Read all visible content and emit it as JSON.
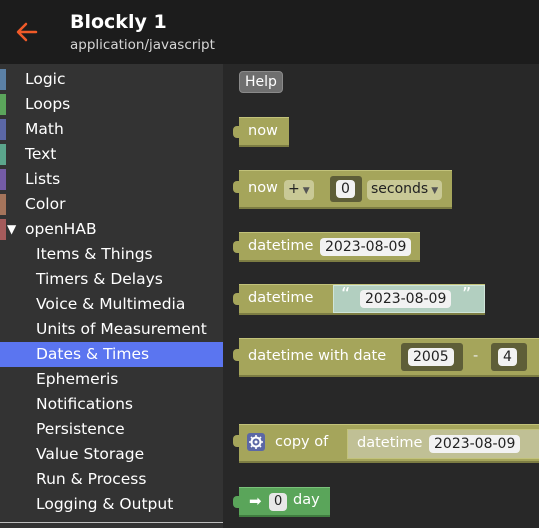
{
  "header": {
    "title": "Blockly 1",
    "subtitle": "application/javascript"
  },
  "toolbox": {
    "categories": [
      {
        "label": "Logic",
        "color": "#5b80a5"
      },
      {
        "label": "Loops",
        "color": "#5ba55b"
      },
      {
        "label": "Math",
        "color": "#5b67a5"
      },
      {
        "label": "Text",
        "color": "#5ba58c"
      },
      {
        "label": "Lists",
        "color": "#745ba5"
      },
      {
        "label": "Color",
        "color": "#a5745b"
      },
      {
        "label": "openHAB",
        "color": "#a55b5b"
      }
    ],
    "subcategories": [
      {
        "label": "Items & Things"
      },
      {
        "label": "Timers & Delays"
      },
      {
        "label": "Voice & Multimedia"
      },
      {
        "label": "Units of Measurement"
      },
      {
        "label": "Dates & Times",
        "selected": true
      },
      {
        "label": "Ephemeris"
      },
      {
        "label": "Notifications"
      },
      {
        "label": "Persistence"
      },
      {
        "label": "Value Storage"
      },
      {
        "label": "Run & Process"
      },
      {
        "label": "Logging & Output"
      }
    ],
    "expand_glyph": "▼"
  },
  "workspace": {
    "help_label": "Help",
    "blocks": {
      "now": {
        "label": "now"
      },
      "now_plus": {
        "label": "now",
        "operator": "+",
        "amount": "0",
        "unit": "seconds"
      },
      "datetime": {
        "label": "datetime",
        "value": "2023-08-09"
      },
      "datetime_text": {
        "label": "datetime",
        "value": "2023-08-09",
        "open_quote": "“",
        "close_quote": "”"
      },
      "datetime_with_date": {
        "label": "datetime with date",
        "year": "2005",
        "separator": "-",
        "month": "4"
      },
      "copy_of": {
        "label": "copy of",
        "inner_label": "datetime",
        "inner_value": "2023-08-09"
      },
      "duration": {
        "amount": "0",
        "unit": "day"
      }
    }
  },
  "colors": {
    "accent_selected": "#5b75f0",
    "block_datetime": "#a5a55b",
    "back_arrow": "#f05a28"
  }
}
